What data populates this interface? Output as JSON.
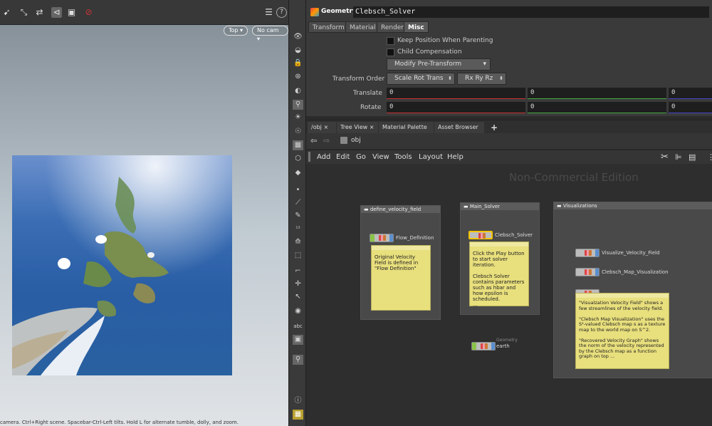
{
  "viewport": {
    "view_menu": "Top ▾",
    "camera_menu": "No cam ▾",
    "status_text": "camera. Ctrl+Right scene. Spacebar-Ctrl-Left tilts. Hold L for alternate tumble, dolly, and zoom."
  },
  "params": {
    "type_label": "Geometry",
    "node_name": "Clebsch_Solver",
    "tabs": [
      "Transform",
      "Material",
      "Render",
      "Misc"
    ],
    "active_tab": "Misc",
    "keep_position": "Keep Position When Parenting",
    "child_compensation": "Child Compensation",
    "modify_pretransform": "Modify Pre-Transform",
    "transform_order_label": "Transform Order",
    "transform_order_value": "Scale Rot Trans",
    "rotate_order_value": "Rx Ry Rz",
    "translate_label": "Translate",
    "rotate_label": "Rotate",
    "translate": [
      "0",
      "0",
      "0"
    ],
    "rotate": [
      "0",
      "0",
      "0"
    ]
  },
  "network": {
    "tabs": [
      "/obj",
      "Tree View",
      "Material Palette",
      "Asset Browser"
    ],
    "path": "obj",
    "menu": [
      "Add",
      "Edit",
      "Go",
      "View",
      "Tools",
      "Layout",
      "Help"
    ],
    "watermark": "Non-Commercial Edition",
    "boxes": {
      "define": "define_velocity_field",
      "main": "Main_Solver",
      "viz": "Visualizations"
    },
    "nodes": {
      "flow": "Flow_Definition",
      "clebsch": "Clebsch_Solver",
      "vis_field": "Visualize_Velocity_Field",
      "vis_map": "Clebsch_Map_Visualization",
      "earth_type": "Geometry",
      "earth": "earth"
    },
    "notes": {
      "flow": "Original Velocity Field is defined in \"Flow Definition\"",
      "solver": "Click the Play button to start solver iteration.\n\nClebsch Solver contains parameters such as hbar and how epsilon is scheduled.\n...",
      "viz": "\"Visualzation Velocity Field\" shows a few streamlines of the velocity field.\n\n\"Clebsch Map Visualization\" uses the S²-valued Clebsch map s as a texture map to the world map on S^2.\n\n\"Recovered Velocity Graph\" shows the norm of the velocity represented by the Clebsch map as a function graph on top ..."
    }
  }
}
